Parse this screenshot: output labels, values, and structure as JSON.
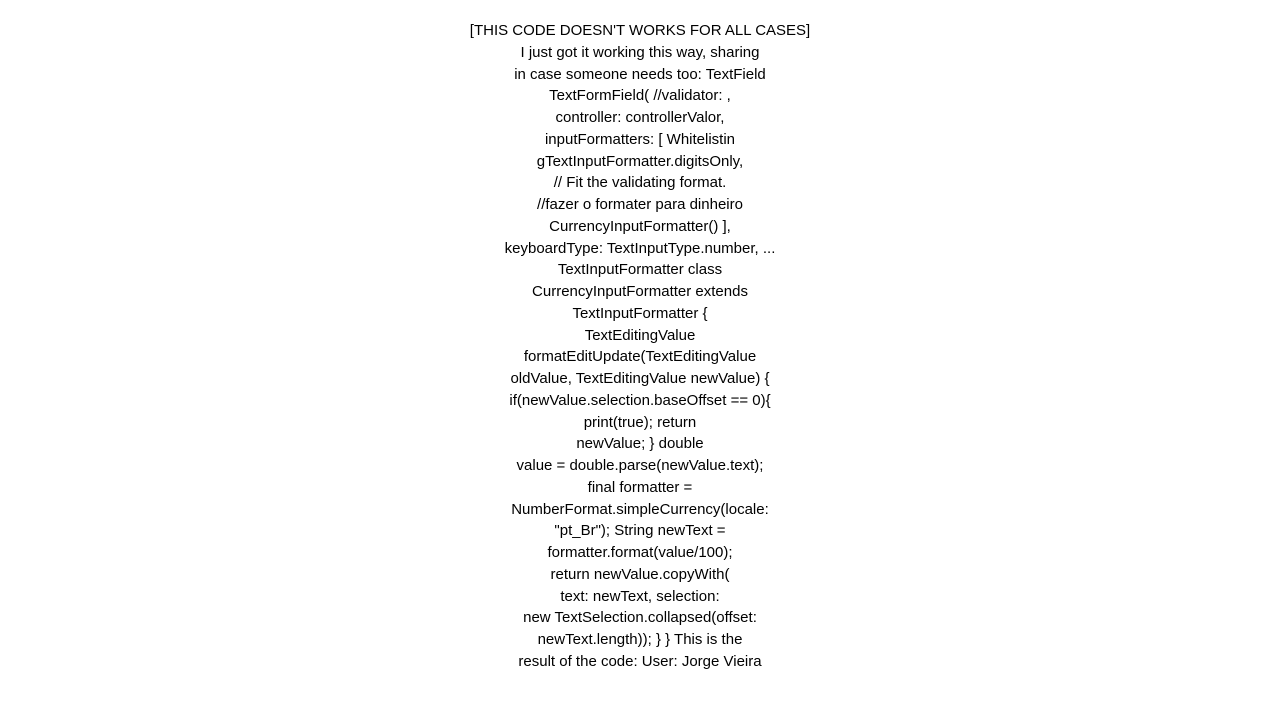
{
  "content": {
    "lines": [
      "[THIS CODE DOESN'T WORKS FOR ALL CASES]",
      "I just got it working this way, sharing",
      "in case someone needs too: TextField",
      "TextFormField(        //validator: ,",
      "controller: controllerValor,",
      "inputFormatters: [            Whitelistin",
      "gTextInputFormatter.digitsOnly,",
      "// Fit the validating format.",
      "//fazer o formater para dinheiro",
      "CurrencyInputFormatter()      ],",
      "keyboardType: TextInputType.number, ...",
      "TextInputFormatter class",
      "CurrencyInputFormatter extends",
      "TextInputFormatter {",
      "TextEditingValue",
      "formatEditUpdate(TextEditingValue",
      "oldValue, TextEditingValue newValue) {",
      "if(newValue.selection.baseOffset == 0){",
      "        print(true);            return",
      "newValue;          }          double",
      "value = double.parse(newValue.text);",
      "final formatter =",
      "NumberFormat.simpleCurrency(locale:",
      "\"pt_Br\");          String newText =",
      "formatter.format(value/100);",
      "return newValue.copyWith(",
      "text: newText,                selection:",
      "new TextSelection.collapsed(offset:",
      "newText.length));      } }  This is the",
      "result of the code:    User: Jorge Vieira"
    ]
  }
}
